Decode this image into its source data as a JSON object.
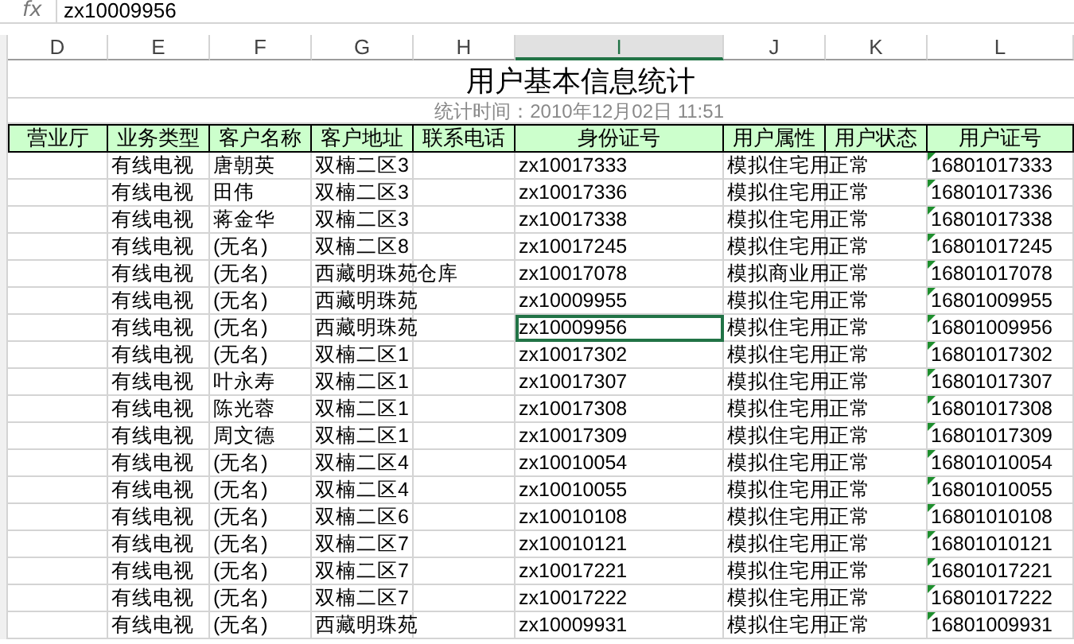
{
  "formula_bar": {
    "function_label": "fx",
    "value": "zx10009956"
  },
  "columns": [
    {
      "label": "D",
      "selected": false
    },
    {
      "label": "E",
      "selected": false
    },
    {
      "label": "F",
      "selected": false
    },
    {
      "label": "G",
      "selected": false
    },
    {
      "label": "H",
      "selected": false
    },
    {
      "label": "I",
      "selected": true
    },
    {
      "label": "J",
      "selected": false
    },
    {
      "label": "K",
      "selected": false
    },
    {
      "label": "L",
      "selected": false
    }
  ],
  "title": "用户基本信息统计",
  "subtitle": "统计时间：2010年12月02日 11:51",
  "table": {
    "headers": [
      "营业厅",
      "业务类型",
      "客户名称",
      "客户地址",
      "联系电话",
      "身份证号",
      "用户属性",
      "用户状态",
      "用户证号"
    ],
    "rows": [
      {
        "service": "有线电视",
        "name": "唐朝英",
        "address": "双楠二区3",
        "id": "zx10017333",
        "property": "模拟住宅用",
        "status": "正常",
        "account": "16801017333",
        "selected": false
      },
      {
        "service": "有线电视",
        "name": "田伟",
        "address": "双楠二区3",
        "id": "zx10017336",
        "property": "模拟住宅用",
        "status": "正常",
        "account": "16801017336",
        "selected": false
      },
      {
        "service": "有线电视",
        "name": "蒋金华",
        "address": "双楠二区3",
        "id": "zx10017338",
        "property": "模拟住宅用",
        "status": "正常",
        "account": "16801017338",
        "selected": false
      },
      {
        "service": "有线电视",
        "name": "(无名)",
        "address": "双楠二区8",
        "id": "zx10017245",
        "property": "模拟住宅用",
        "status": "正常",
        "account": "16801017245",
        "selected": false
      },
      {
        "service": "有线电视",
        "name": "(无名)",
        "address": "西藏明珠苑",
        "phone": "仓库",
        "id": "zx10017078",
        "property": "模拟商业用",
        "status": "正常",
        "account": "16801017078",
        "selected": false
      },
      {
        "service": "有线电视",
        "name": "(无名)",
        "address": "西藏明珠苑",
        "id": "zx10009955",
        "property": "模拟住宅用",
        "status": "正常",
        "account": "16801009955",
        "selected": false
      },
      {
        "service": "有线电视",
        "name": "(无名)",
        "address": "西藏明珠苑",
        "id": "zx10009956",
        "property": "模拟住宅用",
        "status": "正常",
        "account": "16801009956",
        "selected": true
      },
      {
        "service": "有线电视",
        "name": "(无名)",
        "address": "双楠二区1",
        "id": "zx10017302",
        "property": "模拟住宅用",
        "status": "正常",
        "account": "16801017302",
        "selected": false
      },
      {
        "service": "有线电视",
        "name": "叶永寿",
        "address": "双楠二区1",
        "id": "zx10017307",
        "property": "模拟住宅用",
        "status": "正常",
        "account": "16801017307",
        "selected": false
      },
      {
        "service": "有线电视",
        "name": "陈光蓉",
        "address": "双楠二区1",
        "id": "zx10017308",
        "property": "模拟住宅用",
        "status": "正常",
        "account": "16801017308",
        "selected": false
      },
      {
        "service": "有线电视",
        "name": "周文德",
        "address": "双楠二区1",
        "id": "zx10017309",
        "property": "模拟住宅用",
        "status": "正常",
        "account": "16801017309",
        "selected": false
      },
      {
        "service": "有线电视",
        "name": "(无名)",
        "address": "双楠二区4",
        "id": "zx10010054",
        "property": "模拟住宅用",
        "status": "正常",
        "account": "16801010054",
        "selected": false
      },
      {
        "service": "有线电视",
        "name": "(无名)",
        "address": "双楠二区4",
        "id": "zx10010055",
        "property": "模拟住宅用",
        "status": "正常",
        "account": "16801010055",
        "selected": false
      },
      {
        "service": "有线电视",
        "name": "(无名)",
        "address": "双楠二区6",
        "id": "zx10010108",
        "property": "模拟住宅用",
        "status": "正常",
        "account": "16801010108",
        "selected": false
      },
      {
        "service": "有线电视",
        "name": "(无名)",
        "address": "双楠二区7",
        "id": "zx10010121",
        "property": "模拟住宅用",
        "status": "正常",
        "account": "16801010121",
        "selected": false
      },
      {
        "service": "有线电视",
        "name": "(无名)",
        "address": "双楠二区7",
        "id": "zx10017221",
        "property": "模拟住宅用",
        "status": "正常",
        "account": "16801017221",
        "selected": false
      },
      {
        "service": "有线电视",
        "name": "(无名)",
        "address": "双楠二区7",
        "id": "zx10017222",
        "property": "模拟住宅用",
        "status": "正常",
        "account": "16801017222",
        "selected": false
      },
      {
        "service": "有线电视",
        "name": "(无名)",
        "address": "西藏明珠苑",
        "id": "zx10009931",
        "property": "模拟住宅用",
        "status": "正常",
        "account": "16801009931",
        "selected": false
      }
    ]
  }
}
